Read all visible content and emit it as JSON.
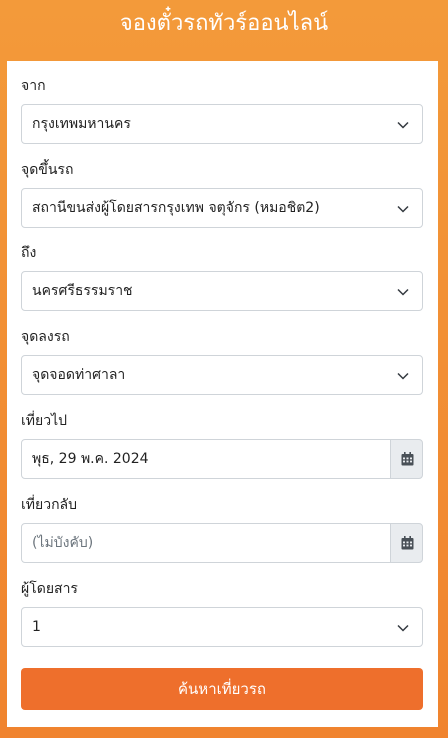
{
  "header": {
    "title": "จองตั๋วรถทัวร์ออนไลน์"
  },
  "form": {
    "from_label": "จาก",
    "from_value": "กรุงเทพมหานคร",
    "pickup_label": "จุดขึ้นรถ",
    "pickup_value": "สถานีขนส่งผู้โดยสารกรุงเทพ จตุจักร (หมอชิต2)",
    "to_label": "ถึง",
    "to_value": "นครศรีธรรมราช",
    "dropoff_label": "จุดลงรถ",
    "dropoff_value": "จุดจอดท่าศาลา",
    "depart_label": "เที่ยวไป",
    "depart_value": "พุธ, 29 พ.ค. 2024",
    "return_label": "เที่ยวกลับ",
    "return_placeholder": "(ไม่บังคับ)",
    "passengers_label": "ผู้โดยสาร",
    "passengers_value": "1",
    "search_label": "ค้นหาเที่ยวรถ"
  },
  "icons": {
    "select_arrow": "chevron-down-icon",
    "date_picker": "calendar-icon"
  },
  "colors": {
    "background_top": "#f39a3a",
    "background_bottom": "#f0832e",
    "button": "#ee6f2c",
    "addon": "#e9ecef"
  }
}
